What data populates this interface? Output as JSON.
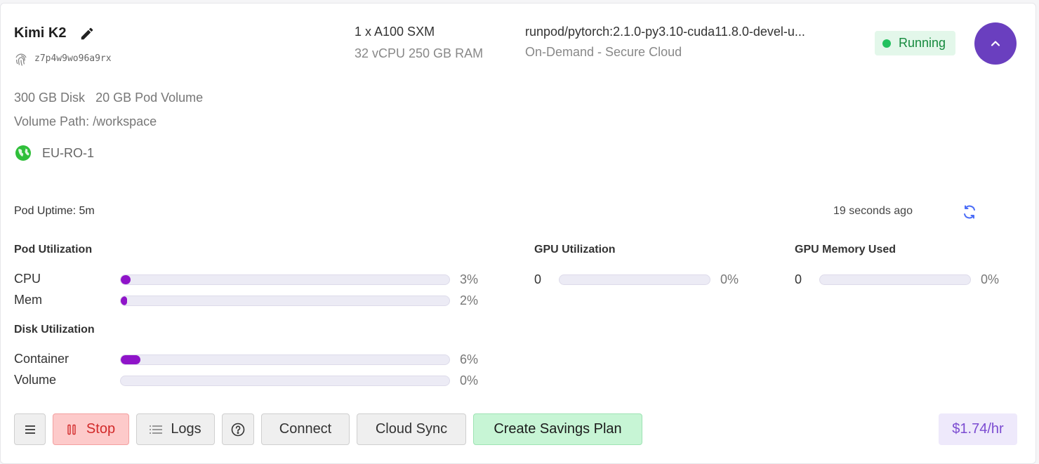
{
  "pod": {
    "name": "Kimi K2",
    "id": "z7p4w9wo96a9rx",
    "gpu": "1 x A100 SXM",
    "spec": "32 vCPU 250 GB RAM",
    "image": "runpod/pytorch:2.1.0-py3.10-cuda11.8.0-devel-u...",
    "cloud": "On-Demand - Secure Cloud",
    "status": "Running",
    "disk": "300 GB Disk",
    "pod_volume": "20 GB Pod Volume",
    "volume_path": "Volume Path: /workspace",
    "region": "EU-RO-1",
    "uptime": "Pod Uptime: 5m",
    "updated": "19 seconds ago",
    "price": "$1.74/hr"
  },
  "colors": {
    "accent": "#6a3fbf",
    "bar_fill": "#8f14c9",
    "status_green": "#22c15e",
    "stop_red": "#d22a2a",
    "refresh_blue": "#4a6cf7"
  },
  "utilization": {
    "pod": {
      "title": "Pod Utilization",
      "rows": [
        {
          "label": "CPU",
          "value": 3,
          "text": "3%"
        },
        {
          "label": "Mem",
          "value": 2,
          "text": "2%"
        }
      ]
    },
    "disk": {
      "title": "Disk Utilization",
      "rows": [
        {
          "label": "Container",
          "value": 6,
          "text": "6%"
        },
        {
          "label": "Volume",
          "value": 0,
          "text": "0%"
        }
      ]
    },
    "gpu": {
      "title": "GPU Utilization",
      "label": "0",
      "value": 0,
      "text": "0%"
    },
    "gpu_mem": {
      "title": "GPU Memory Used",
      "label": "0",
      "value": 0,
      "text": "0%"
    }
  },
  "actions": {
    "stop": "Stop",
    "logs": "Logs",
    "connect": "Connect",
    "cloud_sync": "Cloud Sync",
    "savings": "Create Savings Plan"
  },
  "icons": [
    "edit-icon",
    "fingerprint-icon",
    "chevron-up-icon",
    "globe-icon",
    "refresh-icon",
    "menu-icon",
    "pause-icon",
    "list-icon",
    "help-icon"
  ]
}
